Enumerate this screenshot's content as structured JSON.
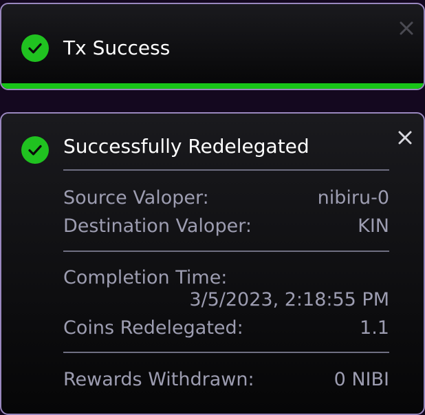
{
  "toasts": {
    "tx": {
      "title": "Tx Success",
      "progress": 1.0,
      "icon": "check-circle-icon",
      "close_icon": "close-icon"
    },
    "redelegate": {
      "title": "Successfully Redelegated",
      "icon": "check-circle-icon",
      "close_icon": "close-icon",
      "fields": {
        "source_valoper_label": "Source Valoper:",
        "source_valoper_value": "nibiru-0",
        "destination_valoper_label": "Destination Valoper:",
        "destination_valoper_value": "KIN",
        "completion_time_label": "Completion Time:",
        "completion_time_value": "3/5/2023, 2:18:55 PM",
        "coins_redelegated_label": "Coins Redelegated:",
        "coins_redelegated_value": "1.1",
        "rewards_withdrawn_label": "Rewards Withdrawn:",
        "rewards_withdrawn_value": "0 NIBI"
      }
    }
  },
  "colors": {
    "success_green": "#20c220",
    "border": "#9a88bf",
    "muted_text": "#9d9db1",
    "divider": "#6f6f82",
    "background": "#14081f"
  }
}
